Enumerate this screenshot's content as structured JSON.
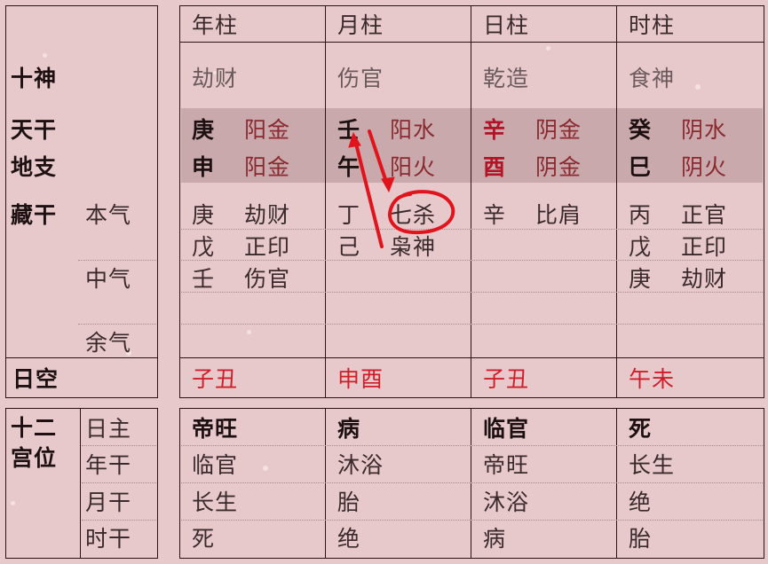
{
  "row_labels": {
    "shishen": "十神",
    "tiangan": "天干",
    "dizhi": "地支",
    "canggan": "藏干",
    "benqi": "本气",
    "zhongqi": "中气",
    "yuqi": "余气",
    "rikong": "日空",
    "shier_gongwei": [
      "十二",
      "宫位"
    ],
    "gongwei_rows": [
      "日主",
      "年干",
      "月干",
      "时干"
    ]
  },
  "columns": [
    {
      "header": "年柱",
      "shishen": "劫财",
      "tiangan": {
        "char": "庚",
        "element": "阳金"
      },
      "dizhi": {
        "char": "申",
        "element": "阳金"
      },
      "canggan": [
        {
          "stem": "庚",
          "god": "劫财"
        },
        {
          "stem": "戊",
          "god": "正印"
        },
        {
          "stem": "壬",
          "god": "伤官"
        }
      ],
      "rikong": "子丑",
      "gongwei": [
        "帝旺",
        "临官",
        "长生",
        "死"
      ]
    },
    {
      "header": "月柱",
      "shishen": "伤官",
      "tiangan": {
        "char": "壬",
        "element": "阳水"
      },
      "dizhi": {
        "char": "午",
        "element": "阳火"
      },
      "canggan": [
        {
          "stem": "丁",
          "god": "七杀"
        },
        {
          "stem": "己",
          "god": "枭神"
        }
      ],
      "rikong": "申酉",
      "gongwei": [
        "病",
        "沐浴",
        "胎",
        "绝"
      ]
    },
    {
      "header": "日柱",
      "shishen": "乾造",
      "tiangan": {
        "char": "辛",
        "element": "阴金"
      },
      "dizhi": {
        "char": "酉",
        "element": "阴金"
      },
      "canggan": [
        {
          "stem": "辛",
          "god": "比肩"
        }
      ],
      "rikong": "子丑",
      "gongwei": [
        "临官",
        "帝旺",
        "沐浴",
        "病"
      ]
    },
    {
      "header": "时柱",
      "shishen": "食神",
      "tiangan": {
        "char": "癸",
        "element": "阴水"
      },
      "dizhi": {
        "char": "巳",
        "element": "阴火"
      },
      "canggan": [
        {
          "stem": "丙",
          "god": "正官"
        },
        {
          "stem": "戊",
          "god": "正印"
        },
        {
          "stem": "庚",
          "god": "劫财"
        }
      ],
      "rikong": "午未",
      "gongwei": [
        "死",
        "长生",
        "绝",
        "胎"
      ]
    }
  ],
  "annotation": {
    "color": "#e0141c",
    "circled_text": "七杀",
    "description": "red arrows linking 壬 (month stem) and 七杀 (hidden stem 丁)"
  }
}
